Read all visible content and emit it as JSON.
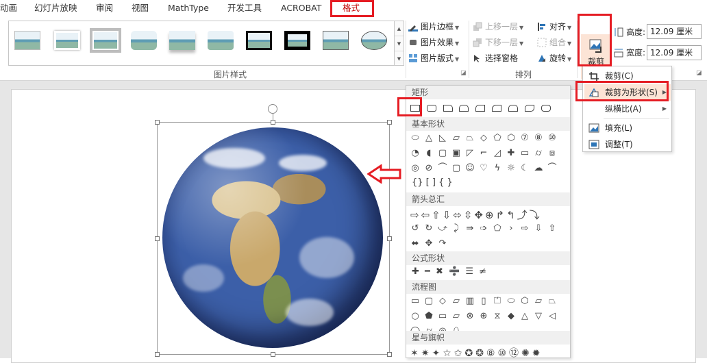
{
  "tabs": [
    "动画",
    "幻灯片放映",
    "审阅",
    "视图",
    "MathType",
    "开发工具",
    "ACROBAT",
    "格式"
  ],
  "ribbon": {
    "picture_styles_label": "图片样式",
    "arrange_label": "排列",
    "picture_border": "图片边框",
    "picture_effects": "图片效果",
    "picture_layout": "图片版式",
    "bring_forward": "上移一层",
    "send_backward": "下移一层",
    "selection_pane": "选择窗格",
    "align": "对齐",
    "group": "组合",
    "rotate": "旋转",
    "crop": "裁剪",
    "height_label": "高度:",
    "height_value": "12.09 厘米",
    "width_label": "宽度:",
    "width_value": "12.09 厘米"
  },
  "crop_menu": {
    "crop": "裁剪(C)",
    "crop_to_shape": "裁剪为形状(S)",
    "aspect_ratio": "纵横比(A)",
    "fill": "填充(L)",
    "fit": "调整(T)"
  },
  "shapes_panel": {
    "categories": [
      "矩形",
      "基本形状",
      "箭头总汇",
      "公式形状",
      "流程图",
      "星与旗帜"
    ],
    "basic_row3_text": "{}  [  ]  {  }",
    "equation_symbols": "✚ ━ ✖ ➗ ☰ ≠",
    "arrows_symbols": "⇨⇦⇧⇩⬄⇳✥⊕↱↰⤴⤵",
    "stars_symbols": "✶✷✦☆✩✪❂⑧⑩⑫✺✹"
  },
  "colors": {
    "accent": "#c00000",
    "highlight": "#fce4d6",
    "annotation": "#e51c23"
  }
}
